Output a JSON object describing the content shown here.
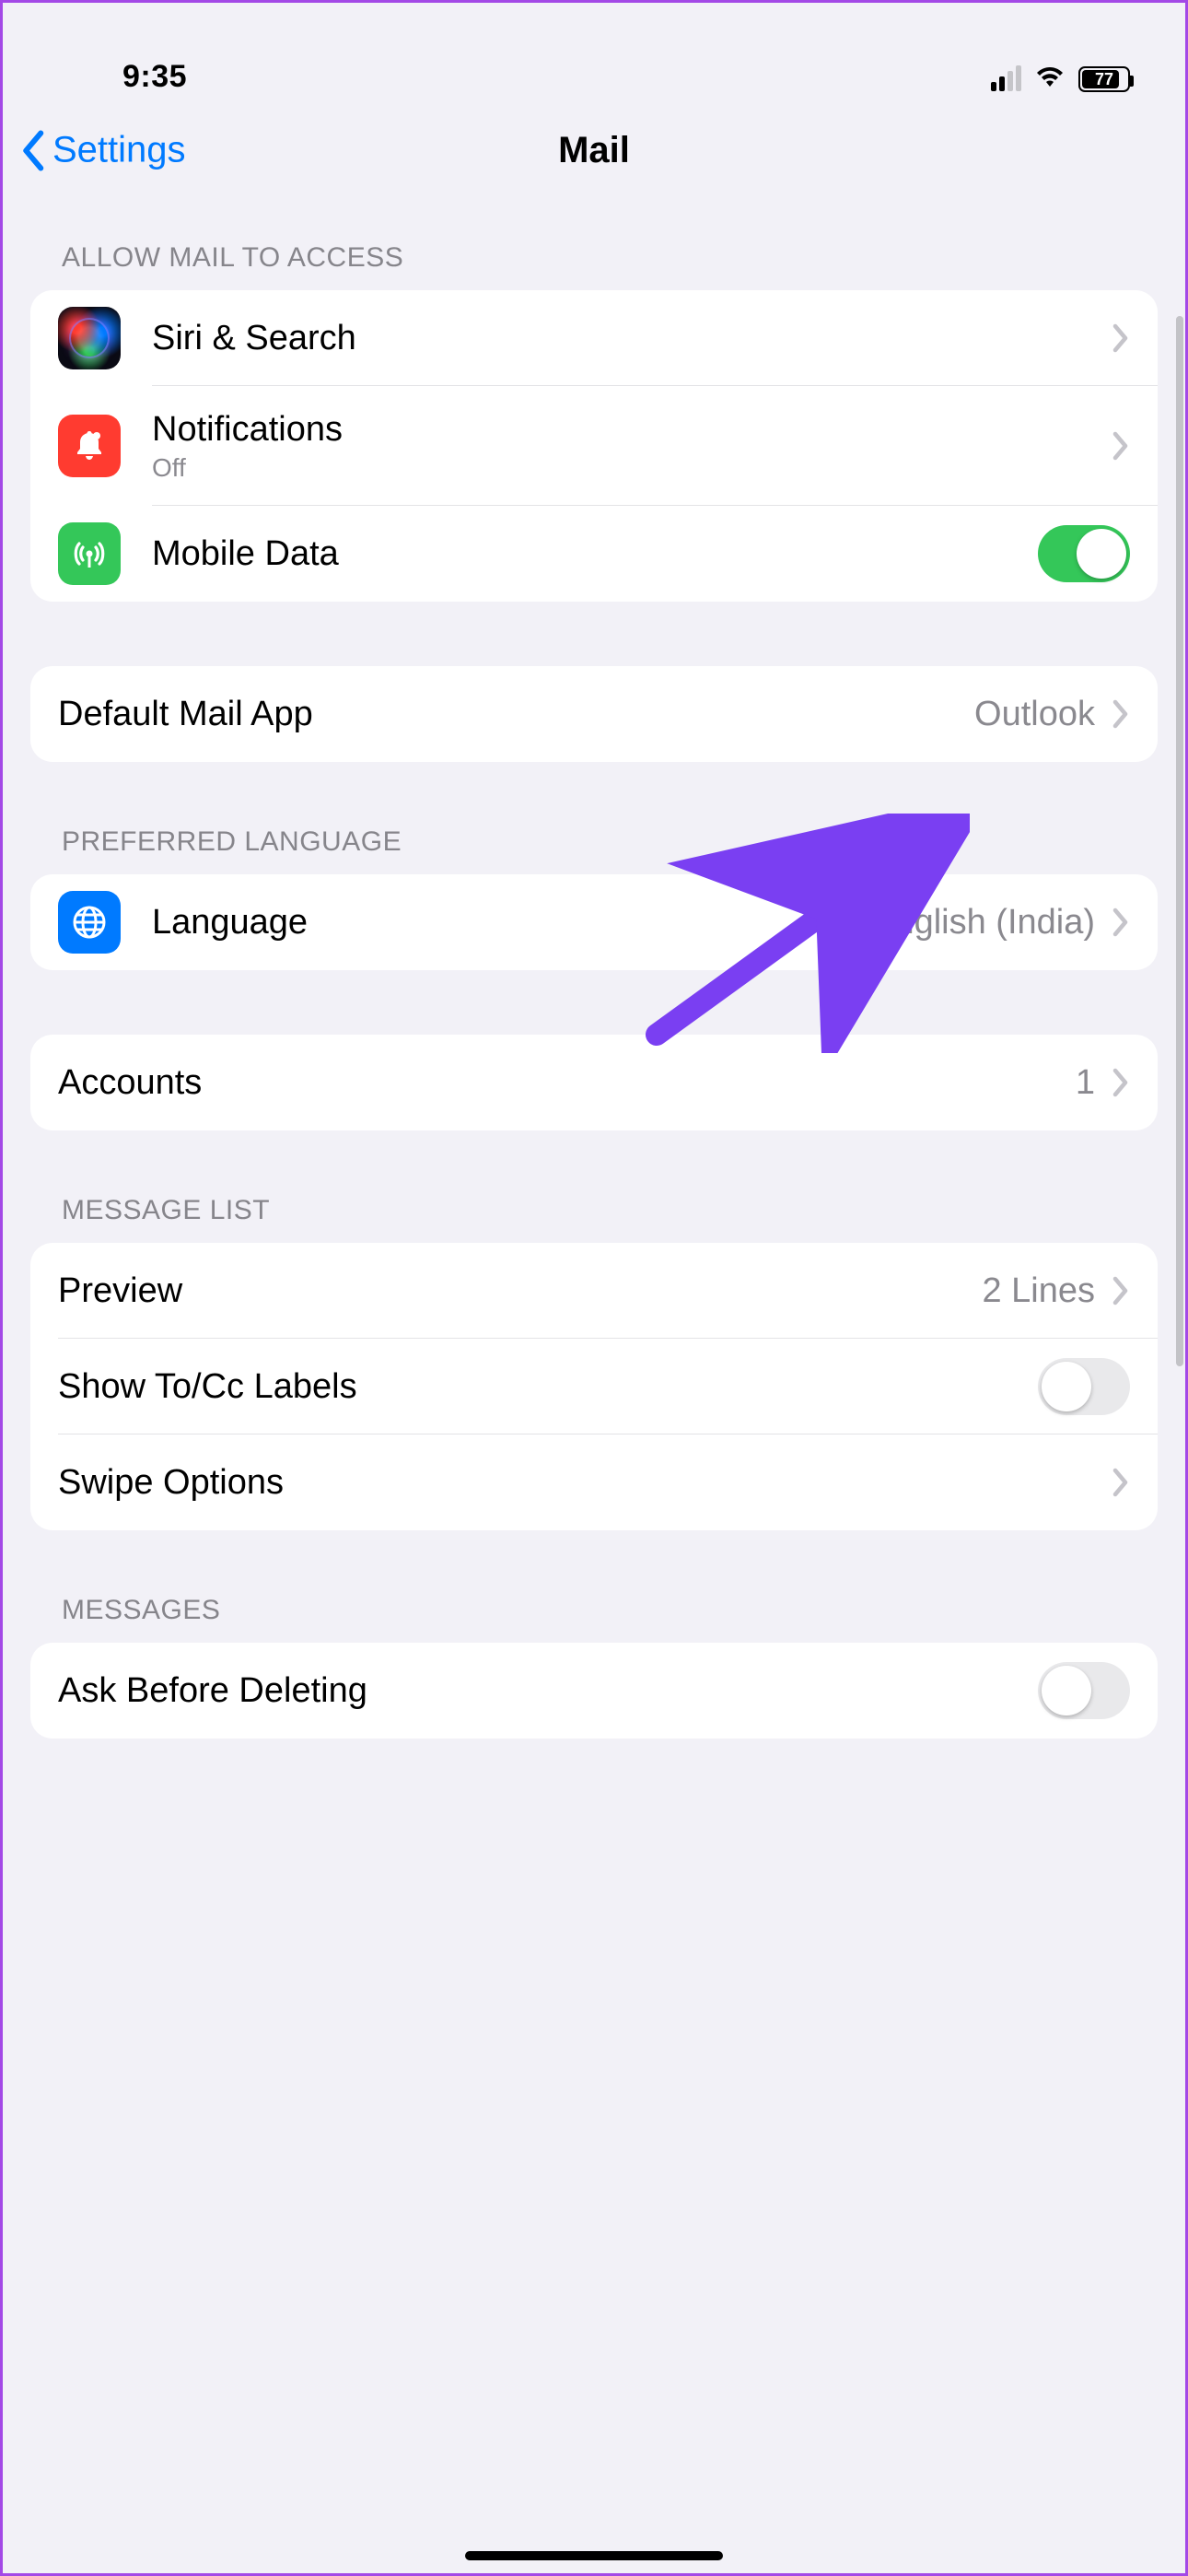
{
  "status": {
    "time": "9:35",
    "battery_pct": "77"
  },
  "nav": {
    "back_label": "Settings",
    "title": "Mail"
  },
  "sections": {
    "access": {
      "header": "ALLOW MAIL TO ACCESS",
      "siri": "Siri & Search",
      "notifications": "Notifications",
      "notifications_sub": "Off",
      "mobile_data": "Mobile Data",
      "mobile_data_on": true
    },
    "default_app": {
      "label": "Default Mail App",
      "value": "Outlook"
    },
    "language": {
      "header": "PREFERRED LANGUAGE",
      "label": "Language",
      "value": "English (India)"
    },
    "accounts": {
      "label": "Accounts",
      "value": "1"
    },
    "message_list": {
      "header": "MESSAGE LIST",
      "preview_label": "Preview",
      "preview_value": "2 Lines",
      "show_tocc": "Show To/Cc Labels",
      "show_tocc_on": false,
      "swipe": "Swipe Options"
    },
    "messages": {
      "header": "MESSAGES",
      "ask_delete": "Ask Before Deleting",
      "ask_delete_on": false
    }
  }
}
